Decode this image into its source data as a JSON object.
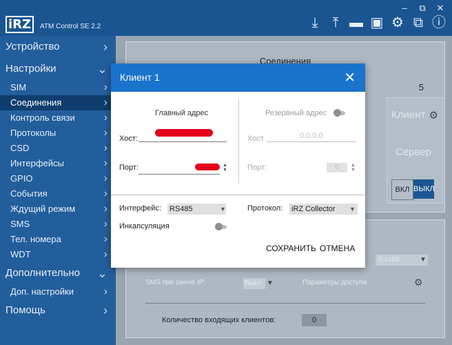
{
  "app": {
    "logo": "iRZ",
    "title": "ATM Control SE 2.2",
    "window_buttons": [
      "–",
      "⧉",
      "✕"
    ],
    "toolbar_icons": [
      "download-icon",
      "upload-icon",
      "folder-icon",
      "save-icon",
      "gear-icon",
      "swap-icon",
      "info-icon"
    ]
  },
  "sidebar": {
    "sections": [
      {
        "label": "Устройство",
        "chevron": "›"
      },
      {
        "label": "Настройки",
        "chevron": "⌄"
      }
    ],
    "items": [
      {
        "label": "SIM"
      },
      {
        "label": "Соединения"
      },
      {
        "label": "Контроль связи"
      },
      {
        "label": "Протоколы"
      },
      {
        "label": "CSD"
      },
      {
        "label": "Интерфейсы"
      },
      {
        "label": "GPIO"
      },
      {
        "label": "События"
      },
      {
        "label": "Ждущий режим"
      },
      {
        "label": "SMS"
      },
      {
        "label": "Тел. номера"
      },
      {
        "label": "WDT"
      }
    ],
    "section_extra": {
      "label": "Дополнительно"
    },
    "extra_items": [
      {
        "label": "Доп. настройки"
      }
    ],
    "section_help": {
      "label": "Помощь"
    }
  },
  "main": {
    "connections_title": "Соединения",
    "column_number": "5",
    "card": {
      "client_label": "Клиент",
      "server_label": "Сервер",
      "on_label": "ВКЛ",
      "off_label": "ВЫКЛ"
    },
    "lower": {
      "interface_value": "RS485",
      "sms_label": "SMS при смене IP:",
      "sms_value": "Выкл",
      "access_params_label": "Параметры доступа",
      "incoming_clients_label": "Количество входящих клиентов:",
      "incoming_clients_value": "0"
    }
  },
  "dialog": {
    "title": "Клиент 1",
    "main_address_title": "Главный адрес",
    "backup_address_title": "Резервный адрес",
    "host_label": "Хост:",
    "port_label": "Порт:",
    "backup_host_label": "Хост",
    "backup_host_placeholder": "0.0.0.0",
    "backup_port_label": "Порт:",
    "backup_port_value": "0",
    "interface_label": "Интерфейс:",
    "interface_value": "RS485",
    "protocol_label": "Протокол:",
    "protocol_value": "iRZ Collector",
    "encapsulation_label": "Инкапсуляция",
    "save_label": "СОХРАНИТЬ",
    "cancel_label": "ОТМЕНА"
  }
}
